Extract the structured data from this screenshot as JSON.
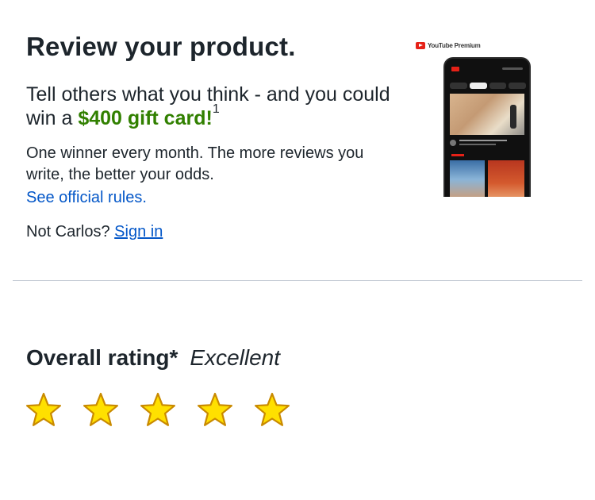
{
  "header": {
    "title": "Review your product."
  },
  "promo": {
    "text_before": "Tell others what you think - and you could win a ",
    "amount": "$400 gift card!",
    "footnote": "1",
    "details": "One winner every month. The more reviews you write, the better your odds.",
    "rules_link": "See official rules.",
    "not_user_prefix": "Not Carlos?",
    "sign_in_link": "Sign in"
  },
  "product_image": {
    "brand": "YouTube Premium"
  },
  "rating": {
    "label": "Overall rating*",
    "value_text": "Excellent",
    "stars_selected": 5,
    "stars_total": 5
  },
  "colors": {
    "accent_green": "#318000",
    "link_blue": "#0457c8",
    "star_fill": "#ffe000",
    "star_stroke": "#c98a00"
  }
}
